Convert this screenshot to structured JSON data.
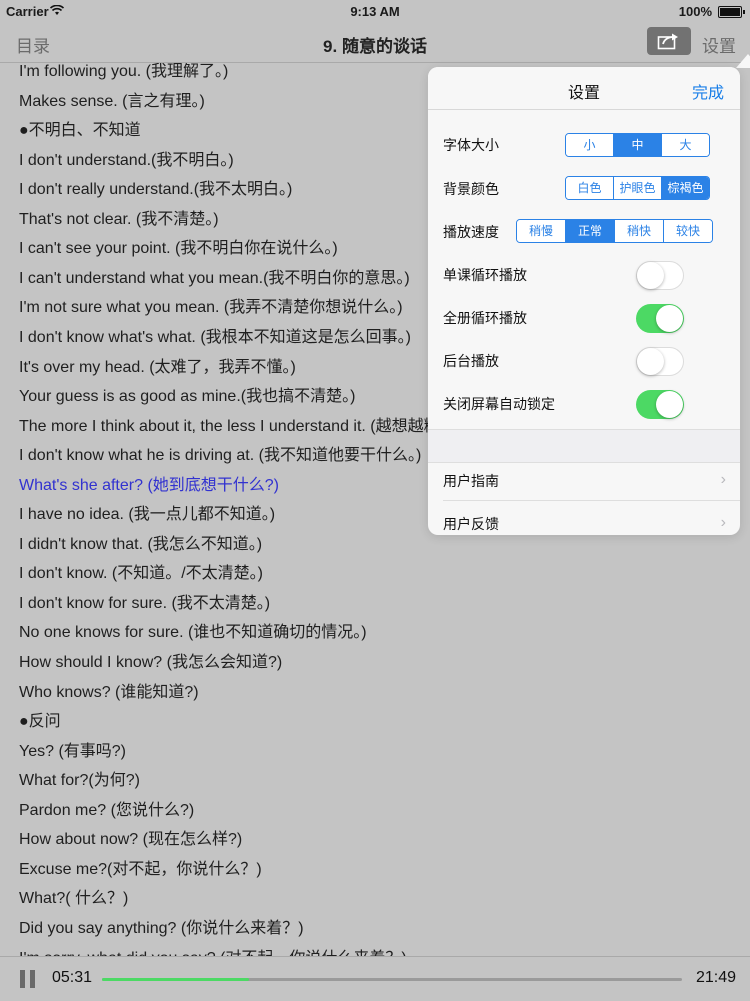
{
  "status": {
    "carrier": "Carrier",
    "time": "9:13 AM",
    "battery": "100%"
  },
  "nav": {
    "back_label": "目录",
    "title": "9. 随意的谈话",
    "settings_label": "设置",
    "share_icon": "share-icon"
  },
  "lines": [
    {
      "text": "I'm following you. (我理解了。)",
      "highlight": false
    },
    {
      "text": "Makes sense. (言之有理。)",
      "highlight": false
    },
    {
      "text": "●不明白、不知道",
      "highlight": false
    },
    {
      "text": "I don't understand.(我不明白。)",
      "highlight": false
    },
    {
      "text": "I don't really understand.(我不太明白。)",
      "highlight": false
    },
    {
      "text": "That's not clear. (我不清楚。)",
      "highlight": false
    },
    {
      "text": "I can't see your point. (我不明白你在说什么。)",
      "highlight": false
    },
    {
      "text": "I can't understand what you mean.(我不明白你的意思。)",
      "highlight": false
    },
    {
      "text": "I'm not sure what you mean. (我弄不清楚你想说什么。)",
      "highlight": false
    },
    {
      "text": "I don't know what's what. (我根本不知道这是怎么回事。)",
      "highlight": false
    },
    {
      "text": "It's over my head. (太难了，我弄不懂。)",
      "highlight": false
    },
    {
      "text": "Your guess is as good as mine.(我也搞不清楚。)",
      "highlight": false
    },
    {
      "text": "The more I think about it, the less I understand it. (越想越糊涂。)",
      "highlight": false
    },
    {
      "text": "I don't know what he is driving at. (我不知道他要干什么。)",
      "highlight": false
    },
    {
      "text": "What's she after? (她到底想干什么?)",
      "highlight": true
    },
    {
      "text": "I have no idea. (我一点儿都不知道。)",
      "highlight": false
    },
    {
      "text": "I didn't know that. (我怎么不知道。)",
      "highlight": false
    },
    {
      "text": "I don't know. (不知道。/不太清楚。)",
      "highlight": false
    },
    {
      "text": "I don't know for sure. (我不太清楚。)",
      "highlight": false
    },
    {
      "text": "No one knows for sure. (谁也不知道确切的情况。)",
      "highlight": false
    },
    {
      "text": "How should I know? (我怎么会知道?)",
      "highlight": false
    },
    {
      "text": "Who knows? (谁能知道?)",
      "highlight": false
    },
    {
      "text": "●反问",
      "highlight": false
    },
    {
      "text": "Yes? (有事吗?)",
      "highlight": false
    },
    {
      "text": "What for?(为何?)",
      "highlight": false
    },
    {
      "text": "Pardon me? (您说什么?)",
      "highlight": false
    },
    {
      "text": "How about now? (现在怎么样?)",
      "highlight": false
    },
    {
      "text": "Excuse me?(对不起，你说什么？)",
      "highlight": false
    },
    {
      "text": "What?( 什么？)",
      "highlight": false
    },
    {
      "text": "Did you say anything? (你说什么来着？)",
      "highlight": false
    },
    {
      "text": "I'm sorry, what did you say? (对不起，你说什么来着？)",
      "highlight": false
    }
  ],
  "settings": {
    "title": "设置",
    "done_label": "完成",
    "font_size": {
      "label": "字体大小",
      "options": [
        "小",
        "中",
        "大"
      ],
      "selected": 1
    },
    "bg_color": {
      "label": "背景颜色",
      "options": [
        "白色",
        "护眼色",
        "棕褐色"
      ],
      "selected": 2
    },
    "speed": {
      "label": "播放速度",
      "options": [
        "稍慢",
        "正常",
        "稍快",
        "较快"
      ],
      "selected": 1
    },
    "toggles": [
      {
        "label": "单课循环播放",
        "on": false
      },
      {
        "label": "全册循环播放",
        "on": true
      },
      {
        "label": "后台播放",
        "on": false
      },
      {
        "label": "关闭屏幕自动锁定",
        "on": true
      }
    ],
    "links": [
      {
        "label": "用户指南"
      },
      {
        "label": "用户反馈"
      }
    ]
  },
  "player": {
    "current_time": "05:31",
    "total_time": "21:49",
    "progress": 0.254,
    "accent": "#4cd964"
  }
}
